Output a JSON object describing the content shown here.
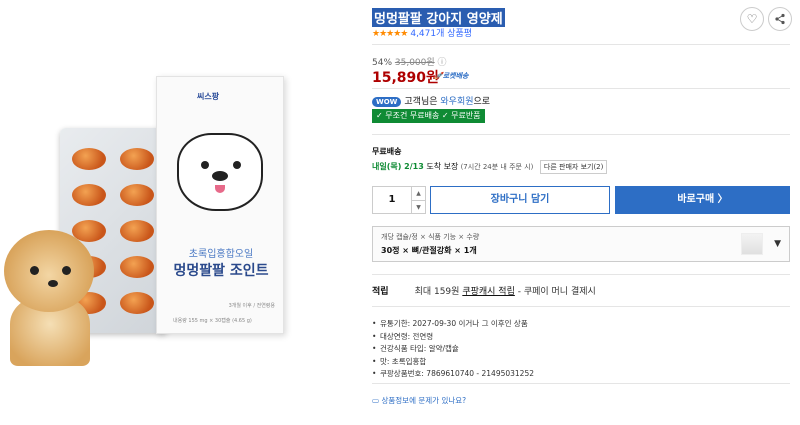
{
  "product": {
    "title": "멍멍팔팔 강아지 영양제",
    "stars": "★★★★★",
    "review_count": "4,471개 상품평",
    "rating": 5,
    "discount_rate": "54%",
    "original_price": "35,000원",
    "price": "15,890원",
    "rocket_badge": "로켓배송",
    "image": {
      "brand_logo": "씨스팡",
      "box_line1": "초록입홍합오일",
      "box_line2": "멍멍팔팔 조인트",
      "box_small1": "3개월 이후 / 전연령용",
      "box_small2": "내용량 155 mg × 30캡슐 (4.65 g)"
    }
  },
  "wow": {
    "badge": "WOW",
    "prefix": "고객님은 ",
    "member": "와우회원",
    "suffix": "으로"
  },
  "benefits": "✓ 무조건 무료배송 ✓ 무료반품",
  "shipping": {
    "label": "무료배송",
    "date": "내일(목) 2/13",
    "guarantee": " 도착 보장",
    "note": " (7시간 24분 내 주문 시)",
    "other_seller": "다른 판매자 보기(2)"
  },
  "purchase": {
    "quantity": "1",
    "up": "▲",
    "down": "▼",
    "cart_label": "장바구니 담기",
    "buy_label": "바로구매  〉"
  },
  "option": {
    "label": "개당 캡슐/정 × 식품 기능 × 수량",
    "value": "30정 × 뼈/관절강화 × 1개",
    "arrow": "▼"
  },
  "cash": {
    "label": "적립",
    "prefix": "최대 159원 ",
    "link": "쿠팡캐시 적립",
    "suffix": " - 쿠페이 머니 결제시"
  },
  "details": [
    "유통기한: 2027-09-30 이거나 그 이후인 상품",
    "대상연령: 전연령",
    "건강식품 타입: 알약/캡슐",
    "맛: 초록입홍합",
    "쿠팡상품번호: 7869610740 - 21495031252"
  ],
  "report": "상품정보에 문제가 있나요?",
  "icons": {
    "heart": "♡",
    "share": "share-icon",
    "info": "ⓘ"
  }
}
